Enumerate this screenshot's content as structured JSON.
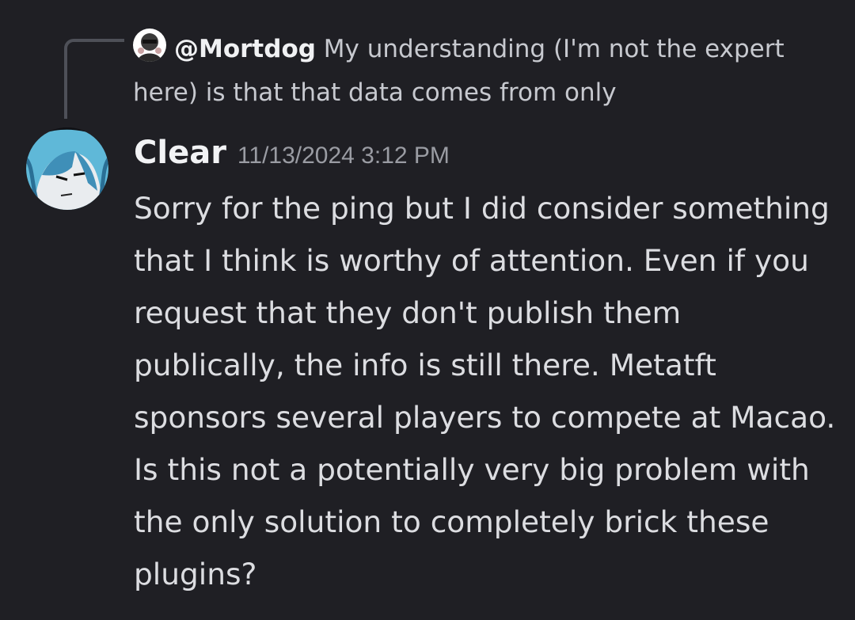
{
  "reply": {
    "author": "@Mortdog",
    "preview_text": "My understanding (I'm not the expert here) is that that data comes from only",
    "avatar_icon": "user-avatar-icon"
  },
  "message": {
    "author": "Clear",
    "timestamp": "11/13/2024 3:12 PM",
    "avatar_icon": "user-avatar-icon",
    "content": "Sorry for the ping but I did consider something that I think is worthy of attention. Even if you request that they don't publish them publically, the info is still there. Metatft sponsors several players to compete at Macao. Is this not a potentially very big problem with the only solution to completely brick these plugins?"
  },
  "colors": {
    "background": "#1f1f24",
    "username": "#f2f3f5",
    "timestamp": "#9a9ca3",
    "message_text": "#dcdde1",
    "reply_spine": "#4e5058"
  }
}
